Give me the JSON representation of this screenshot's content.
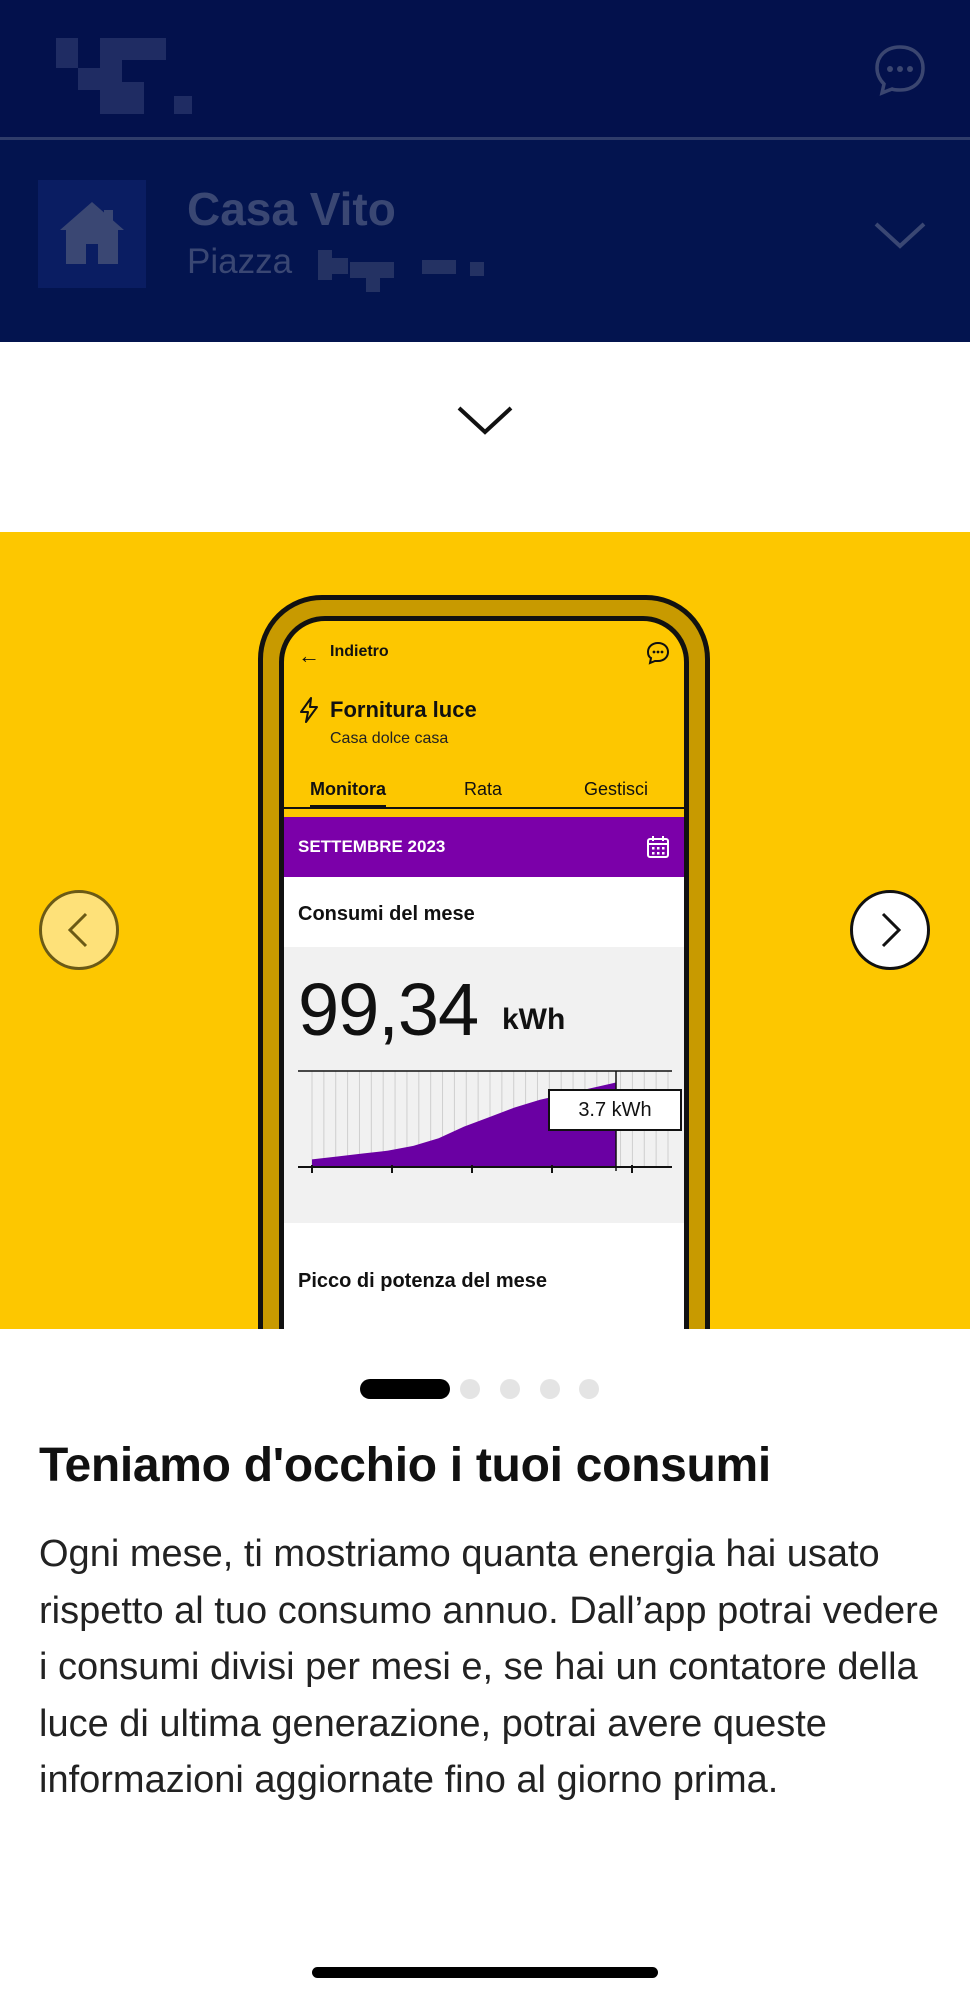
{
  "header": {
    "logo_icon": "brand-logo-pixelated",
    "chat_icon": "chat-bubble-icon"
  },
  "location": {
    "title": "Casa Vito",
    "subtitle": "Piazza",
    "home_icon": "home-icon",
    "chevron_icon": "chevron-down-icon"
  },
  "sheet": {
    "handle_icon": "chevron-down-icon"
  },
  "carousel": {
    "active_index": 0,
    "page_count": 5,
    "prev_icon": "chevron-left-icon",
    "next_icon": "chevron-right-icon",
    "background_color": "#fdc700"
  },
  "mockup": {
    "back_label": "Indietro",
    "supply_title": "Fornitura luce",
    "supply_subtitle": "Casa dolce casa",
    "tabs": [
      "Monitora",
      "Rata",
      "Gestisci"
    ],
    "active_tab": "Monitora",
    "month": "SETTEMBRE 2023",
    "month_bar_color": "#7b00a9",
    "consumption_title": "Consumi del mese",
    "consumption_value": "99,34",
    "consumption_unit": "kWh",
    "tooltip": "3.7 kWh",
    "chart_series": [
      8,
      11,
      14,
      17,
      22,
      30,
      42,
      52,
      62,
      70,
      76,
      82,
      88
    ],
    "peak_title": "Picco di potenza del mese"
  },
  "content": {
    "headline": "Teniamo d'occhio i tuoi consumi",
    "body": "Ogni mese, ti mostriamo quanta energia hai usato rispetto al tuo consumo annuo. Dall’app potrai vedere i consumi divisi per mesi e, se hai un contatore della luce di ultima generazione, potrai avere queste informazioni aggiornate fino al giorno prima."
  }
}
